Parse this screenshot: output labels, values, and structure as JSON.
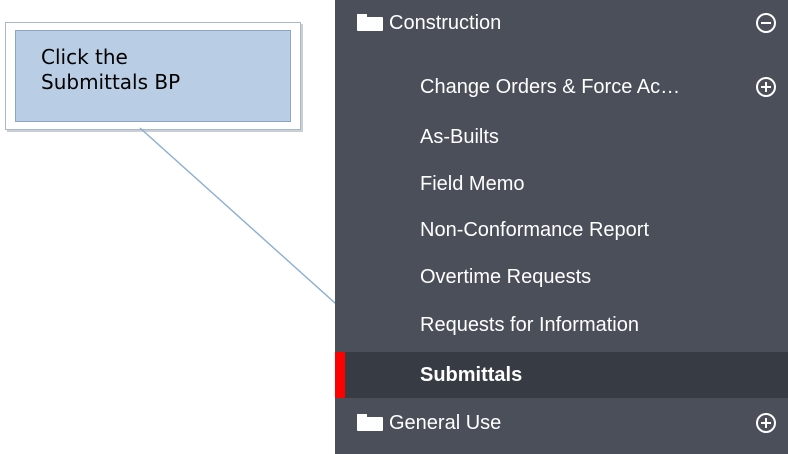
{
  "callout": {
    "line1": "Click the",
    "line2": "Submittals BP"
  },
  "sidebar": {
    "folders": [
      {
        "label": "Construction",
        "icon": "collapse-icon"
      },
      {
        "label": "General Use",
        "icon": "expand-icon"
      }
    ],
    "items": [
      {
        "label": "Change Orders & Force Ac…",
        "icon": "expand-icon"
      },
      {
        "label": "As-Builts"
      },
      {
        "label": "Field Memo"
      },
      {
        "label": "Non-Conformance Report"
      },
      {
        "label": "Overtime Requests"
      },
      {
        "label": "Requests for Information"
      },
      {
        "label": "Submittals",
        "active": true
      }
    ],
    "colors": {
      "panel": "#4a4f5a",
      "active_row": "#373b44",
      "active_marker": "#ff0000",
      "text": "#ffffff"
    }
  }
}
